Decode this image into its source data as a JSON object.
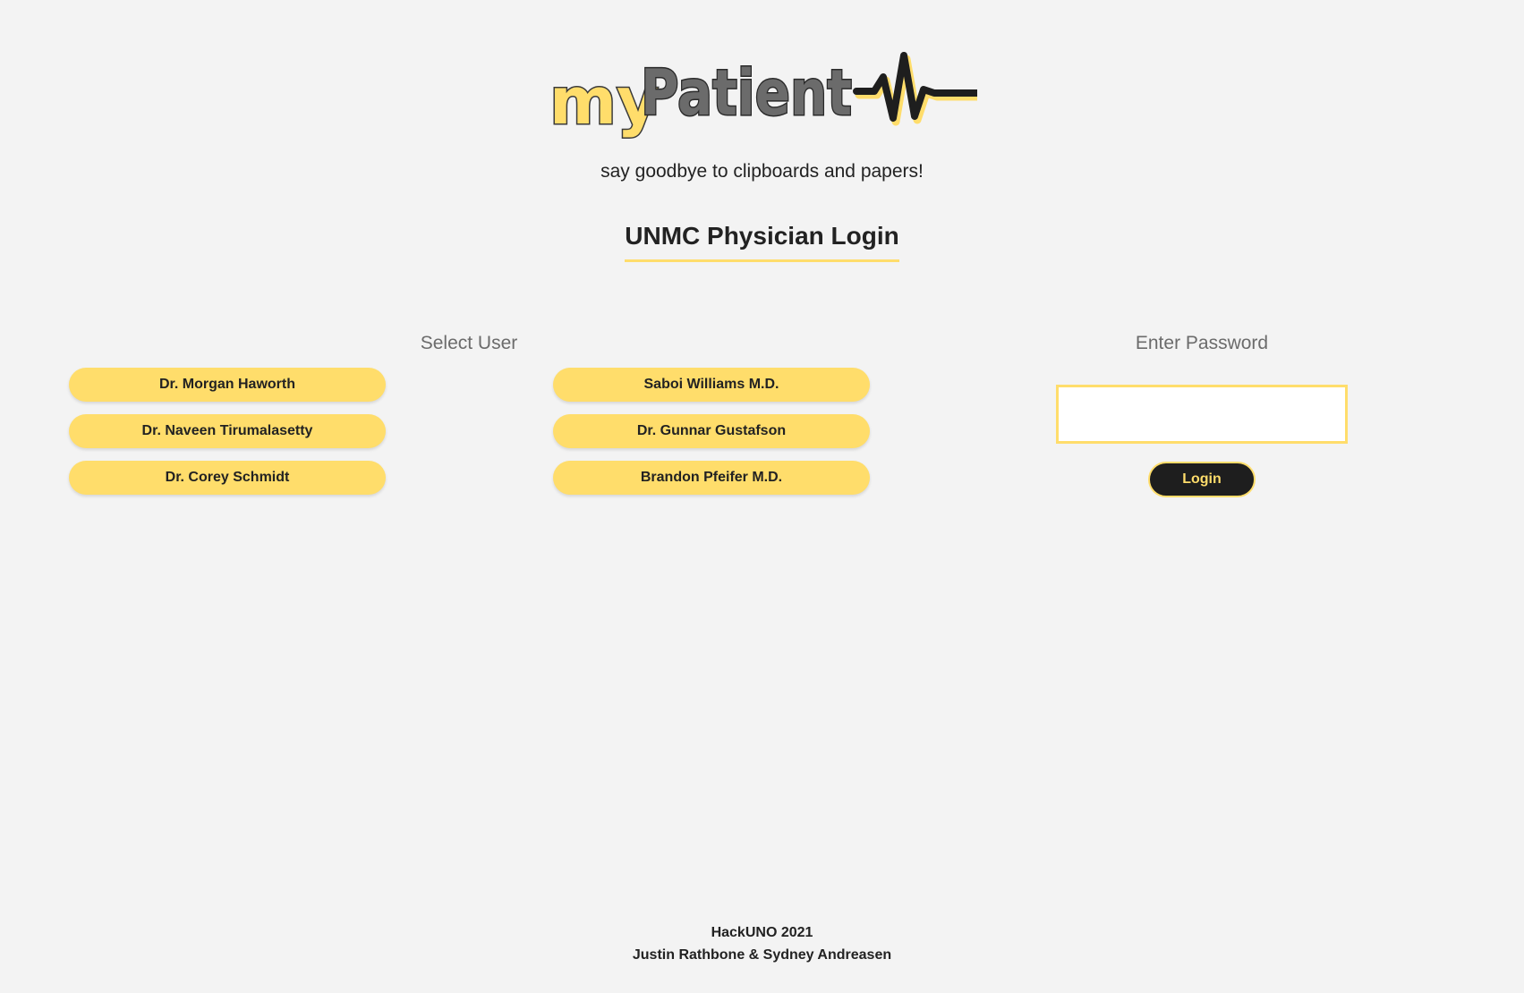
{
  "brand": {
    "logo_text_my": "my",
    "logo_text_patient": "Patient",
    "tagline": "say goodbye to clipboards and papers!"
  },
  "header": {
    "title": "UNMC Physician Login"
  },
  "select_user": {
    "label": "Select User",
    "users": [
      "Dr. Morgan Haworth",
      "Dr. Naveen Tirumalasetty",
      "Dr. Corey Schmidt",
      "Saboi Williams M.D.",
      "Dr. Gunnar Gustafson",
      "Brandon Pfeifer M.D."
    ]
  },
  "password": {
    "label": "Enter Password",
    "value": "",
    "login_label": "Login"
  },
  "footer": {
    "line1": "HackUNO 2021",
    "line2": "Justin Rathbone & Sydney Andreasen"
  },
  "colors": {
    "accent": "#ffdd6b",
    "dark": "#1e1e1e",
    "background": "#f3f3f3",
    "logo_gray": "#6b6b6b"
  }
}
